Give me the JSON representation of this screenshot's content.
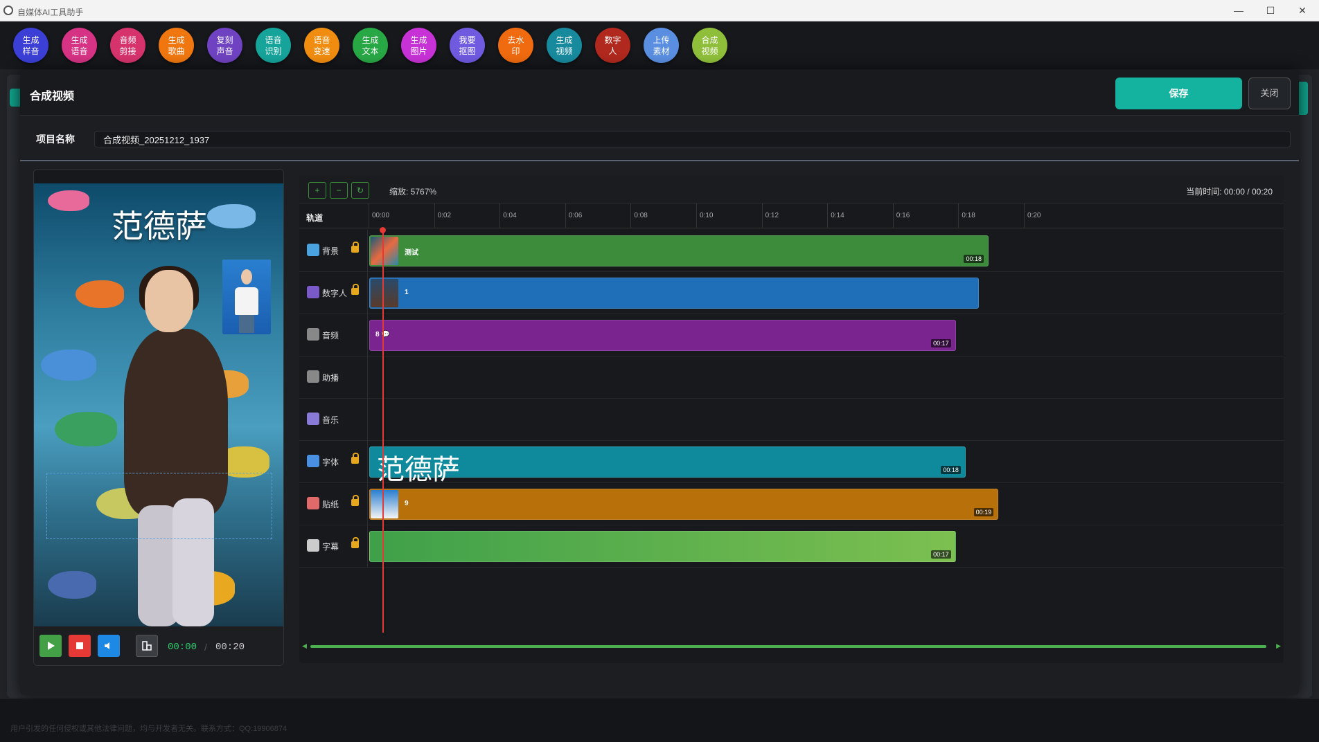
{
  "window": {
    "title": "自媒体AI工具助手",
    "minimize": "—",
    "maximize": "☐",
    "close": "✕"
  },
  "toolbar": [
    {
      "label": "生成\n样音",
      "color": "#3b3fd6",
      "name": "generate-sample-voice-button"
    },
    {
      "label": "生成\n语音",
      "color": "#d63384",
      "name": "generate-voice-button"
    },
    {
      "label": "音频\n剪接",
      "color": "#d6336c",
      "name": "audio-edit-button"
    },
    {
      "label": "生成\n歌曲",
      "color": "#f0770f",
      "name": "generate-song-button"
    },
    {
      "label": "复刻\n声音",
      "color": "#6f42c1",
      "name": "clone-voice-button"
    },
    {
      "label": "语音\n识别",
      "color": "#15a39a",
      "name": "speech-recognition-button"
    },
    {
      "label": "语音\n变速",
      "color": "#f08c0f",
      "name": "speech-speed-button"
    },
    {
      "label": "生成\n文本",
      "color": "#28a745",
      "name": "generate-text-button"
    },
    {
      "label": "生成\n图片",
      "color": "#c732d6",
      "name": "generate-image-button"
    },
    {
      "label": "我要\n抠图",
      "color": "#6f5ae0",
      "name": "cutout-button"
    },
    {
      "label": "去水\n印",
      "color": "#f06a0f",
      "name": "remove-watermark-button"
    },
    {
      "label": "生成\n视频",
      "color": "#178a9e",
      "name": "generate-video-button"
    },
    {
      "label": "数字\n人",
      "color": "#b0281e",
      "name": "digital-human-button"
    },
    {
      "label": "上传\n素材",
      "color": "#5a8ee0",
      "name": "upload-material-button"
    },
    {
      "label": "合成\n视频",
      "color": "#8fbf3a",
      "name": "compose-video-button"
    }
  ],
  "dialog": {
    "title": "合成视频",
    "save": "保存",
    "close": "关闭",
    "project_label": "项目名称",
    "project_name": "合成视频_20251212_1937"
  },
  "preview": {
    "title_text": "范德萨",
    "current": "00:00",
    "sep": "/",
    "total": "00:20"
  },
  "timeline": {
    "zoom_in": "+",
    "zoom_out": "−",
    "reset": "↻",
    "zoom_label": "缩放: 5767%",
    "current_time": "当前时间: 00:00 / 00:20",
    "track_header": "轨道",
    "ticks": [
      "00:00",
      "0:02",
      "0:04",
      "0:06",
      "0:08",
      "0:10",
      "0:12",
      "0:14",
      "0:16",
      "0:18",
      "0:20"
    ],
    "tracks": [
      {
        "name": "背景",
        "icon": "image-icon",
        "icon_color": "#4aa3df",
        "locked": true,
        "clip": {
          "label": "测试",
          "dur": "00:18",
          "color": "#3c8c3c",
          "start": 0,
          "end": 18.9
        }
      },
      {
        "name": "数字人",
        "icon": "person-icon",
        "icon_color": "#7a5ac8",
        "locked": true,
        "clip": {
          "label": "1",
          "dur": "",
          "color": "#1f6fb8",
          "start": 0,
          "end": 18.6
        }
      },
      {
        "name": "音频",
        "icon": "mic-icon",
        "icon_color": "#888",
        "locked": false,
        "clip": {
          "label": "8 💬",
          "dur": "00:17",
          "color": "#7a2490",
          "start": 0,
          "end": 17.9
        }
      },
      {
        "name": "助播",
        "icon": "microphone-icon",
        "icon_color": "#888",
        "locked": false,
        "clip": null
      },
      {
        "name": "音乐",
        "icon": "music-icon",
        "icon_color": "#8a7ad8",
        "locked": false,
        "clip": null
      },
      {
        "name": "字体",
        "icon": "text-icon",
        "icon_color": "#4a90e2",
        "locked": true,
        "clip": {
          "label": "范德萨",
          "dur": "00:18",
          "color": "#0e8a9c",
          "start": 0,
          "end": 18.2
        }
      },
      {
        "name": "贴纸",
        "icon": "palette-icon",
        "icon_color": "#e06a6a",
        "locked": true,
        "clip": {
          "label": "9",
          "dur": "00:19",
          "color": "#b8700a",
          "start": 0,
          "end": 19.2
        }
      },
      {
        "name": "字幕",
        "icon": "subtitle-icon",
        "icon_color": "#ccc",
        "locked": true,
        "clip": {
          "label": "",
          "dur": "00:17",
          "color": "#55a84a",
          "start": 0,
          "end": 17.9
        }
      }
    ]
  },
  "footer": {
    "text": "用户引发的任何侵权或其他法律问题，均与开发者无关。联系方式：QQ:19906874"
  }
}
